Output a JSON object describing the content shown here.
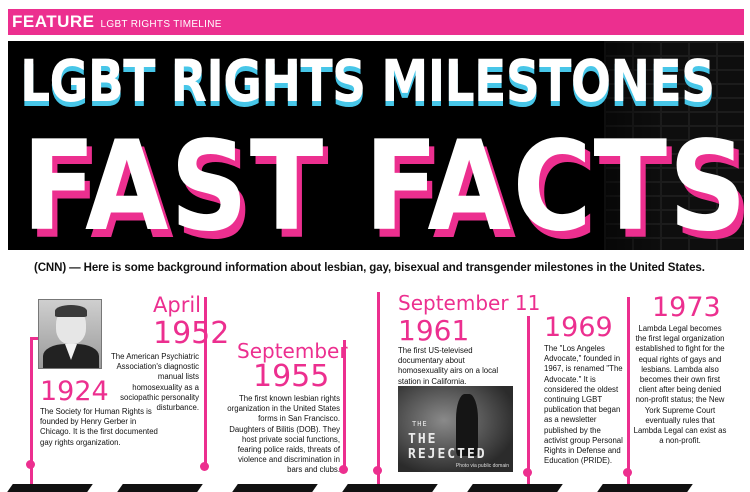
{
  "header": {
    "feature_label": "FEATURE",
    "section_label": "LGBT RIGHTS TIMELINE"
  },
  "hero": {
    "headline": "LGBT RIGHTS MILESTONES",
    "subheadline": "FAST FACTS"
  },
  "intro": "(CNN) — Here is some background information about lesbian, gay, bisexual and transgender milestones in the United States.",
  "events": [
    {
      "month": "",
      "year": "1924",
      "text": "The Society for Human Rights is founded by Henry Gerber in Chicago. It is the first documented gay rights organization."
    },
    {
      "month": "April",
      "year": "1952",
      "text": "The American Psychiatric Association's diagnostic manual lists homosexuality as a sociopathic personality disturbance."
    },
    {
      "month": "September",
      "year": "1955",
      "text": "The first known lesbian rights organization in the United States forms in San Francisco. Daughters of Bilitis (DOB). They host private social functions, fearing police raids, threats of violence and discrimination in bars and clubs."
    },
    {
      "month": "September 11",
      "year": "1961",
      "text": "The first US-televised documentary about homosexuality airs on a local station in California.",
      "photo_title": "THE REJECTED",
      "photo_credit": "Photo via public domain"
    },
    {
      "month": "",
      "year": "1969",
      "text": "The \"Los Angeles Advocate,\" founded in 1967, is renamed \"The Advocate.\" It is considered the oldest continuing LGBT publication that began as a newsletter published by the activist group Personal Rights in Defense and Education (PRIDE)."
    },
    {
      "month": "",
      "year": "1973",
      "text": "Lambda Legal becomes the first legal organization established to fight for the equal rights of gays and lesbians. Lambda also becomes their own first client after being denied non-profit status; the New York Supreme Court eventually rules that Lambda Legal can exist as a non-profit."
    }
  ],
  "colors": {
    "accent": "#ec2f8f",
    "hero_bg": "#000000",
    "headline_shadow": "#47c6e8"
  }
}
